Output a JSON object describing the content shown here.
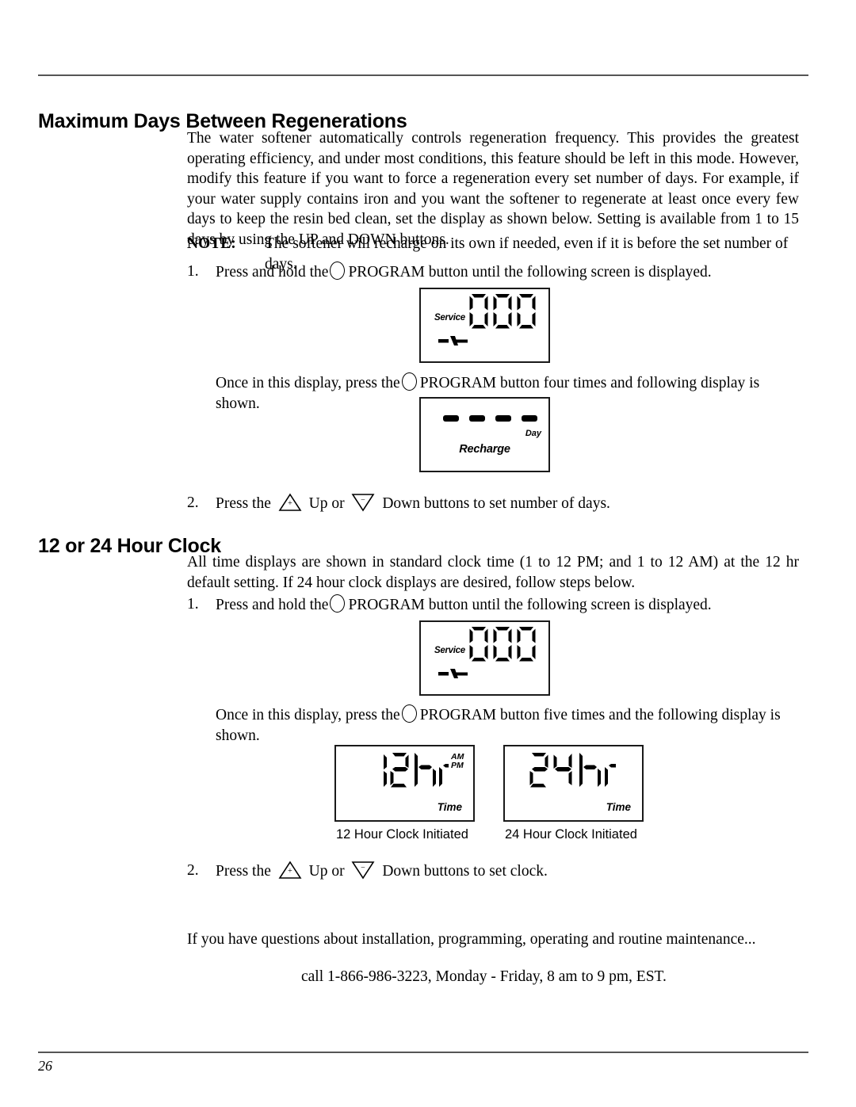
{
  "page": {
    "number": "26"
  },
  "sections": [
    {
      "heading": "Maximum Days Between Regenerations",
      "intro": "The water softener automatically controls regeneration frequency. This provides the greatest operating efficiency, and under most conditions, this feature should be left in this mode.  However, modify this feature if you want to force a regeneration every set number of days. For example, if your water supply contains iron and you want the softener to regenerate at least once every few days to keep the resin bed clean, set the display as shown below. Setting is available from 1 to 15 days by using the UP and DOWN buttons.",
      "note_label": "NOTE:",
      "note_text": "The softener will recharge on its own if needed, even if it is before the set number of days.",
      "step1_num": "1.",
      "step1_before": "Press and hold the",
      "step1_after": "PROGRAM button until  the following screen is displayed.",
      "press_again_before": "Once in this display, press the",
      "press_again_after": "PROGRAM button four times and following display is shown.",
      "step2_num": "2.",
      "step2_a": "Press the",
      "step2_b": "Up or",
      "step2_c": "Down buttons to set number of days."
    },
    {
      "heading": "12 or 24 Hour Clock",
      "intro": "All time displays are shown in standard clock time (1 to 12 PM; and 1 to 12 AM) at the 12 hr default setting. If 24 hour clock displays are desired, follow steps below.",
      "step1_num": "1.",
      "step1_before": "Press and hold the",
      "step1_after": "PROGRAM button until  the following screen is displayed.",
      "press_again_before": "Once in this display, press the",
      "press_again_after": "PROGRAM button five times and the following display is shown.",
      "step2_num": "2.",
      "step2_a": "Press the",
      "step2_b": "Up or",
      "step2_c": "Down buttons to set clock."
    }
  ],
  "lcd": {
    "service_label": "Service",
    "service_digits": "000",
    "recharge_dashes": "- - - -",
    "day_label": "Day",
    "recharge_label": "Recharge",
    "clock_12": "12hr",
    "clock_24": "24hr",
    "am_label": "AM",
    "pm_label": "PM",
    "time_label": "Time",
    "caption_12": "12 Hour Clock Initiated",
    "caption_24": "24 Hour Clock Initiated"
  },
  "icons": {
    "program_button": "circle-button-icon",
    "up_button": "up-triangle-plus-icon",
    "down_button": "down-triangle-minus-icon",
    "faucet": "faucet-icon",
    "plus_sign": "+",
    "minus_sign": "−"
  },
  "footer": {
    "questions": "If you have questions about installation, programming, operating and routine maintenance...",
    "call": "call 1-866-986-3223, Monday - Friday, 8 am to 9 pm, EST."
  }
}
